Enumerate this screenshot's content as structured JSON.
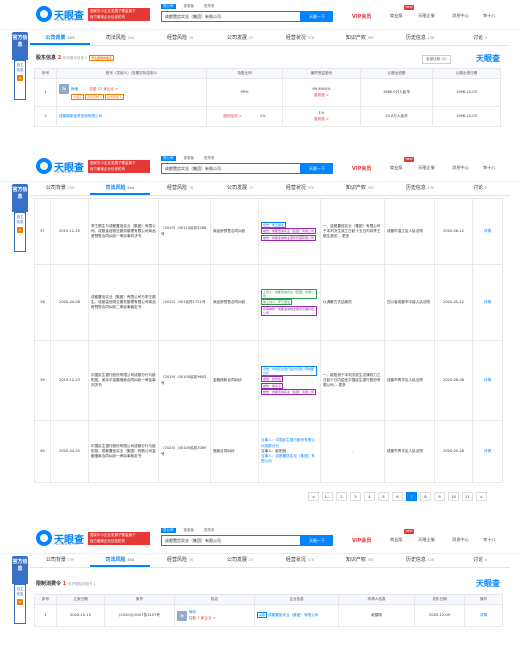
{
  "header": {
    "logo_name": "天眼查",
    "logo_sub": "TianYanCha.com",
    "promo_line1": "国家中小企业发展子基金旗下",
    "promo_line2": "官方备案企业征信机构",
    "search_tabs": [
      "查公司",
      "查老板",
      "查关系"
    ],
    "search_value": "成都置信实业（集团）有限公司",
    "search_button": "天眼一下",
    "vip": "VIP会员",
    "nav": [
      "商业版",
      "天眼企服",
      "消息中心",
      "李十八"
    ],
    "new_badge": "NEW"
  },
  "side": {
    "banner": "官方信息",
    "menu_label": "自主信息",
    "menu_count": "6"
  },
  "tabs": [
    {
      "label": "公司背景",
      "count": "239"
    },
    {
      "label": "司法风险",
      "count": "344"
    },
    {
      "label": "经营风险",
      "count": "76"
    },
    {
      "label": "公司发展",
      "count": "23"
    },
    {
      "label": "经营状况",
      "count": "376"
    },
    {
      "label": "知识产权",
      "count": "367"
    },
    {
      "label": "历史信息",
      "count": "136"
    },
    {
      "label": "讨论",
      "count": "0"
    }
  ],
  "section1": {
    "title": "股东信息",
    "count": "2",
    "sub": "历史股东信息 2",
    "hint": "发生变更的股东",
    "sort_label": "全部比例 (2)",
    "watermark": "天眼查",
    "columns": [
      "序号",
      "股东（发起人）/查看实际控制人",
      "持股比例",
      "最终受益股份",
      "认缴出资额",
      "认缴出资日期"
    ],
    "rows": [
      {
        "no": "1",
        "avatar": "梅",
        "name": "梅東",
        "tags": [
          "大股东",
          "实际控制人",
          "最终受益人"
        ],
        "link": "控股 22 家企业 >",
        "ratio": "99%",
        "final": "99.9900%",
        "final_link": "股权链 >",
        "amount": "1980.0万人民币",
        "date": "1996-10-03"
      },
      {
        "no": "2",
        "name": "成都鼎新投资咨询有限公司",
        "link": "股权结构 >",
        "ratio": "1%",
        "final": "1%",
        "final_link": "股权链 >",
        "amount": "20.0万人民币",
        "date": "1996-10-03"
      }
    ]
  },
  "section2": {
    "columns": [
      "序号",
      "日期",
      "案由",
      "案号",
      "案件类型",
      "案件身份",
      "裁判结果",
      "审理法院",
      "发布日期",
      "操作"
    ],
    "rows": [
      {
        "no": "57",
        "date": "2019-11-25",
        "title": "李王额生与成都置信实业（集团）有限公司、成都金信物业服务管理有限公司商品房预售合同纠纷一审民事判决书",
        "case_no": "（2019）川0115民初4268号",
        "case_type": "商品房预售合同纠纷",
        "parties": [
          "原告：李王额生",
          "被告：成都置信实业（集团）有限公司",
          "被告：成都金信物业服务管理有限公司"
        ],
        "result": "一、成都置信实业（集团）有限公司于本判决生效之日起十五日内向李王额生退还… 更多",
        "court": "成都市温江区人民法院",
        "pub": "2020-06-12",
        "op": "详情"
      },
      {
        "no": "58",
        "date": "2020-04-08",
        "title": "成都置信实业（集团）有限公司与李王额生、成都金信物业服务管理有限公司商品房预售合同纠纷二审民事裁定书",
        "case_no": "（2020）川01民终1721号",
        "case_type": "商品房预售合同纠纷",
        "parties": [
          "上诉人：成都置信实业（集团）有限公司",
          "被上诉人：李王额生",
          "原审被告：成都金信物业服务管理有限公司"
        ],
        "result": "以调解方式结案的",
        "court": "四川省成都市中级人民法院",
        "pub": "2020-05-12",
        "op": "详情"
      },
      {
        "no": "59",
        "date": "2019-12-23",
        "title": "中国民生银行股份有限公司成都分行与欧阳旭、吴永平金融借款合同纠纷一审民事判决书",
        "case_no": "（2019）川0105民初9602号",
        "case_type": "金融借款合同纠纷",
        "parties": [
          "原告：中国民生银行股份有限公司成都分行",
          "被告：欧阳旭",
          "被告：吴永平",
          "被告：成都置信实业（集团）有限公司"
        ],
        "result": "一、欧阳旭于本判决发生法律效力之日起十日内偿还中国民生银行股份有限公司… 更多",
        "court": "成都市青羊区人民法院",
        "pub": "2020-06-08",
        "op": "详情"
      },
      {
        "no": "60",
        "date": "2020-04-20",
        "title": "中国民生银行股份有限公司成都分行与欧阳旭、成都置信实业（集团）有限公司金融借款合同纠纷一审民事裁定书",
        "case_no": "（2020）川0105民初2089号",
        "case_type": "借款合同纠纷",
        "parties": [
          "当事人：中国民生银行股份有限公司成都分行",
          "当事人：欧阳旭",
          "当事人：成都置信实业（集团）有限公司"
        ],
        "result": "-",
        "court": "成都市青羊区人民法院",
        "pub": "2020-05-26",
        "op": "详情"
      }
    ],
    "pager": [
      "<",
      "1...",
      "2",
      "3",
      "4",
      "5",
      "6",
      "7",
      "8",
      "9",
      "10",
      "11",
      ">"
    ],
    "pager_active": "7"
  },
  "section3": {
    "title": "限制消费令",
    "count": "1",
    "sub": "历史限制消费令 1",
    "watermark": "天眼查",
    "columns": [
      "序号",
      "立案日期",
      "案号",
      "姓名",
      "企业信息",
      "申请人信息",
      "发布日期",
      "操作"
    ],
    "row": {
      "no": "1",
      "date": "2020-10-15",
      "case_no": "(2020)川0107执3107号",
      "avatar": "梅",
      "name": "梅东",
      "name_link": "控股 7 家企业 >",
      "company": "成都置信实业（集团）有限公司",
      "company_tag": "关联",
      "applicant": "叔建明",
      "pub": "2020-12-09",
      "op": "详情"
    }
  }
}
